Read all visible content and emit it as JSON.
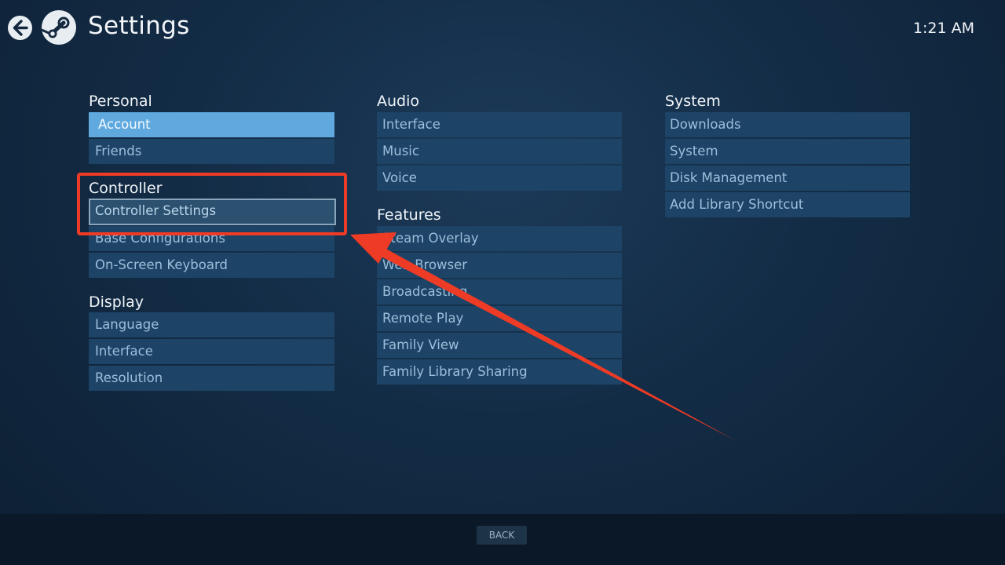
{
  "header": {
    "title": "Settings",
    "time": "1:21 AM"
  },
  "sections": {
    "personal": {
      "title": "Personal",
      "items": [
        "Account",
        "Friends"
      ]
    },
    "controller": {
      "title": "Controller",
      "items": [
        "Controller Settings",
        "Base Configurations",
        "On-Screen Keyboard"
      ]
    },
    "display": {
      "title": "Display",
      "items": [
        "Language",
        "Interface",
        "Resolution"
      ]
    },
    "audio": {
      "title": "Audio",
      "items": [
        "Interface",
        "Music",
        "Voice"
      ]
    },
    "features": {
      "title": "Features",
      "items": [
        "Steam Overlay",
        "Web Browser",
        "Broadcasting",
        "Remote Play",
        "Family View",
        "Family Library Sharing"
      ]
    },
    "system": {
      "title": "System",
      "items": [
        "Downloads",
        "System",
        "Disk Management",
        "Add Library Shortcut"
      ]
    }
  },
  "footer": {
    "back_label": "BACK"
  },
  "colors": {
    "selected": "#5fa9df",
    "item_bg": "#1d4466",
    "annotation": "#ee3b26"
  },
  "icons": {
    "back": "back-arrow-icon",
    "logo": "steam-logo-icon"
  }
}
